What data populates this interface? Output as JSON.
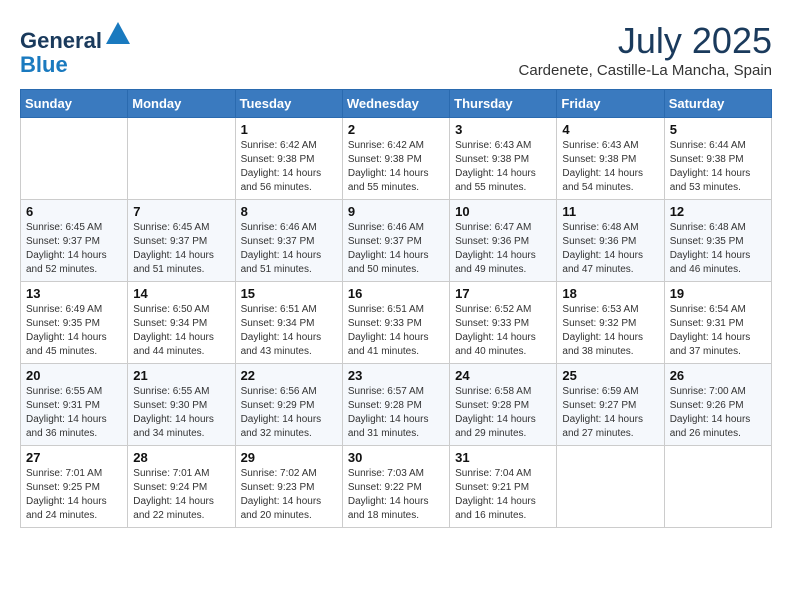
{
  "header": {
    "logo_general": "General",
    "logo_blue": "Blue",
    "month_year": "July 2025",
    "location": "Cardenete, Castille-La Mancha, Spain"
  },
  "days_of_week": [
    "Sunday",
    "Monday",
    "Tuesday",
    "Wednesday",
    "Thursday",
    "Friday",
    "Saturday"
  ],
  "weeks": [
    [
      {
        "day": "",
        "sunrise": "",
        "sunset": "",
        "daylight": ""
      },
      {
        "day": "",
        "sunrise": "",
        "sunset": "",
        "daylight": ""
      },
      {
        "day": "1",
        "sunrise": "Sunrise: 6:42 AM",
        "sunset": "Sunset: 9:38 PM",
        "daylight": "Daylight: 14 hours and 56 minutes."
      },
      {
        "day": "2",
        "sunrise": "Sunrise: 6:42 AM",
        "sunset": "Sunset: 9:38 PM",
        "daylight": "Daylight: 14 hours and 55 minutes."
      },
      {
        "day": "3",
        "sunrise": "Sunrise: 6:43 AM",
        "sunset": "Sunset: 9:38 PM",
        "daylight": "Daylight: 14 hours and 55 minutes."
      },
      {
        "day": "4",
        "sunrise": "Sunrise: 6:43 AM",
        "sunset": "Sunset: 9:38 PM",
        "daylight": "Daylight: 14 hours and 54 minutes."
      },
      {
        "day": "5",
        "sunrise": "Sunrise: 6:44 AM",
        "sunset": "Sunset: 9:38 PM",
        "daylight": "Daylight: 14 hours and 53 minutes."
      }
    ],
    [
      {
        "day": "6",
        "sunrise": "Sunrise: 6:45 AM",
        "sunset": "Sunset: 9:37 PM",
        "daylight": "Daylight: 14 hours and 52 minutes."
      },
      {
        "day": "7",
        "sunrise": "Sunrise: 6:45 AM",
        "sunset": "Sunset: 9:37 PM",
        "daylight": "Daylight: 14 hours and 51 minutes."
      },
      {
        "day": "8",
        "sunrise": "Sunrise: 6:46 AM",
        "sunset": "Sunset: 9:37 PM",
        "daylight": "Daylight: 14 hours and 51 minutes."
      },
      {
        "day": "9",
        "sunrise": "Sunrise: 6:46 AM",
        "sunset": "Sunset: 9:37 PM",
        "daylight": "Daylight: 14 hours and 50 minutes."
      },
      {
        "day": "10",
        "sunrise": "Sunrise: 6:47 AM",
        "sunset": "Sunset: 9:36 PM",
        "daylight": "Daylight: 14 hours and 49 minutes."
      },
      {
        "day": "11",
        "sunrise": "Sunrise: 6:48 AM",
        "sunset": "Sunset: 9:36 PM",
        "daylight": "Daylight: 14 hours and 47 minutes."
      },
      {
        "day": "12",
        "sunrise": "Sunrise: 6:48 AM",
        "sunset": "Sunset: 9:35 PM",
        "daylight": "Daylight: 14 hours and 46 minutes."
      }
    ],
    [
      {
        "day": "13",
        "sunrise": "Sunrise: 6:49 AM",
        "sunset": "Sunset: 9:35 PM",
        "daylight": "Daylight: 14 hours and 45 minutes."
      },
      {
        "day": "14",
        "sunrise": "Sunrise: 6:50 AM",
        "sunset": "Sunset: 9:34 PM",
        "daylight": "Daylight: 14 hours and 44 minutes."
      },
      {
        "day": "15",
        "sunrise": "Sunrise: 6:51 AM",
        "sunset": "Sunset: 9:34 PM",
        "daylight": "Daylight: 14 hours and 43 minutes."
      },
      {
        "day": "16",
        "sunrise": "Sunrise: 6:51 AM",
        "sunset": "Sunset: 9:33 PM",
        "daylight": "Daylight: 14 hours and 41 minutes."
      },
      {
        "day": "17",
        "sunrise": "Sunrise: 6:52 AM",
        "sunset": "Sunset: 9:33 PM",
        "daylight": "Daylight: 14 hours and 40 minutes."
      },
      {
        "day": "18",
        "sunrise": "Sunrise: 6:53 AM",
        "sunset": "Sunset: 9:32 PM",
        "daylight": "Daylight: 14 hours and 38 minutes."
      },
      {
        "day": "19",
        "sunrise": "Sunrise: 6:54 AM",
        "sunset": "Sunset: 9:31 PM",
        "daylight": "Daylight: 14 hours and 37 minutes."
      }
    ],
    [
      {
        "day": "20",
        "sunrise": "Sunrise: 6:55 AM",
        "sunset": "Sunset: 9:31 PM",
        "daylight": "Daylight: 14 hours and 36 minutes."
      },
      {
        "day": "21",
        "sunrise": "Sunrise: 6:55 AM",
        "sunset": "Sunset: 9:30 PM",
        "daylight": "Daylight: 14 hours and 34 minutes."
      },
      {
        "day": "22",
        "sunrise": "Sunrise: 6:56 AM",
        "sunset": "Sunset: 9:29 PM",
        "daylight": "Daylight: 14 hours and 32 minutes."
      },
      {
        "day": "23",
        "sunrise": "Sunrise: 6:57 AM",
        "sunset": "Sunset: 9:28 PM",
        "daylight": "Daylight: 14 hours and 31 minutes."
      },
      {
        "day": "24",
        "sunrise": "Sunrise: 6:58 AM",
        "sunset": "Sunset: 9:28 PM",
        "daylight": "Daylight: 14 hours and 29 minutes."
      },
      {
        "day": "25",
        "sunrise": "Sunrise: 6:59 AM",
        "sunset": "Sunset: 9:27 PM",
        "daylight": "Daylight: 14 hours and 27 minutes."
      },
      {
        "day": "26",
        "sunrise": "Sunrise: 7:00 AM",
        "sunset": "Sunset: 9:26 PM",
        "daylight": "Daylight: 14 hours and 26 minutes."
      }
    ],
    [
      {
        "day": "27",
        "sunrise": "Sunrise: 7:01 AM",
        "sunset": "Sunset: 9:25 PM",
        "daylight": "Daylight: 14 hours and 24 minutes."
      },
      {
        "day": "28",
        "sunrise": "Sunrise: 7:01 AM",
        "sunset": "Sunset: 9:24 PM",
        "daylight": "Daylight: 14 hours and 22 minutes."
      },
      {
        "day": "29",
        "sunrise": "Sunrise: 7:02 AM",
        "sunset": "Sunset: 9:23 PM",
        "daylight": "Daylight: 14 hours and 20 minutes."
      },
      {
        "day": "30",
        "sunrise": "Sunrise: 7:03 AM",
        "sunset": "Sunset: 9:22 PM",
        "daylight": "Daylight: 14 hours and 18 minutes."
      },
      {
        "day": "31",
        "sunrise": "Sunrise: 7:04 AM",
        "sunset": "Sunset: 9:21 PM",
        "daylight": "Daylight: 14 hours and 16 minutes."
      },
      {
        "day": "",
        "sunrise": "",
        "sunset": "",
        "daylight": ""
      },
      {
        "day": "",
        "sunrise": "",
        "sunset": "",
        "daylight": ""
      }
    ]
  ]
}
